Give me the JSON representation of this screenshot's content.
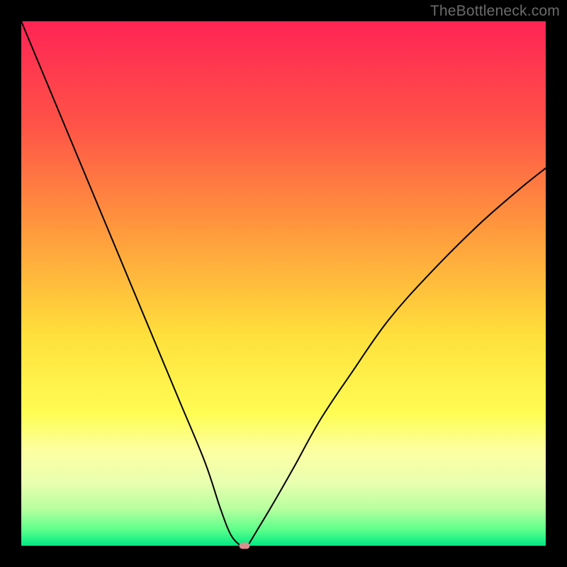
{
  "watermark": "TheBottleneck.com",
  "chart_data": {
    "type": "line",
    "title": "",
    "xlabel": "",
    "ylabel": "",
    "xlim": [
      0,
      100
    ],
    "ylim": [
      0,
      100
    ],
    "grid": false,
    "series": [
      {
        "name": "left-curve",
        "x": [
          0,
          5,
          10,
          15,
          20,
          25,
          30,
          35,
          38,
          40,
          41.8
        ],
        "values": [
          100,
          88,
          76,
          64,
          52,
          40,
          28,
          16,
          7,
          2,
          0
        ]
      },
      {
        "name": "right-curve",
        "x": [
          43.2,
          45,
          48,
          52,
          57,
          63,
          70,
          78,
          87,
          95,
          100
        ],
        "values": [
          0,
          3,
          8,
          15,
          24,
          33,
          43,
          52,
          61,
          68,
          72
        ]
      }
    ],
    "marker": {
      "x": 42.5,
      "y": 0
    },
    "gradient_stops": [
      {
        "pct": 0,
        "color": "#ff2455"
      },
      {
        "pct": 20,
        "color": "#ff5447"
      },
      {
        "pct": 40,
        "color": "#ff9a3d"
      },
      {
        "pct": 60,
        "color": "#ffe03c"
      },
      {
        "pct": 75,
        "color": "#fffd55"
      },
      {
        "pct": 82,
        "color": "#fcffa2"
      },
      {
        "pct": 88,
        "color": "#e9ffb0"
      },
      {
        "pct": 93,
        "color": "#b6ff9f"
      },
      {
        "pct": 97,
        "color": "#5cff8a"
      },
      {
        "pct": 100,
        "color": "#00e884"
      }
    ]
  }
}
